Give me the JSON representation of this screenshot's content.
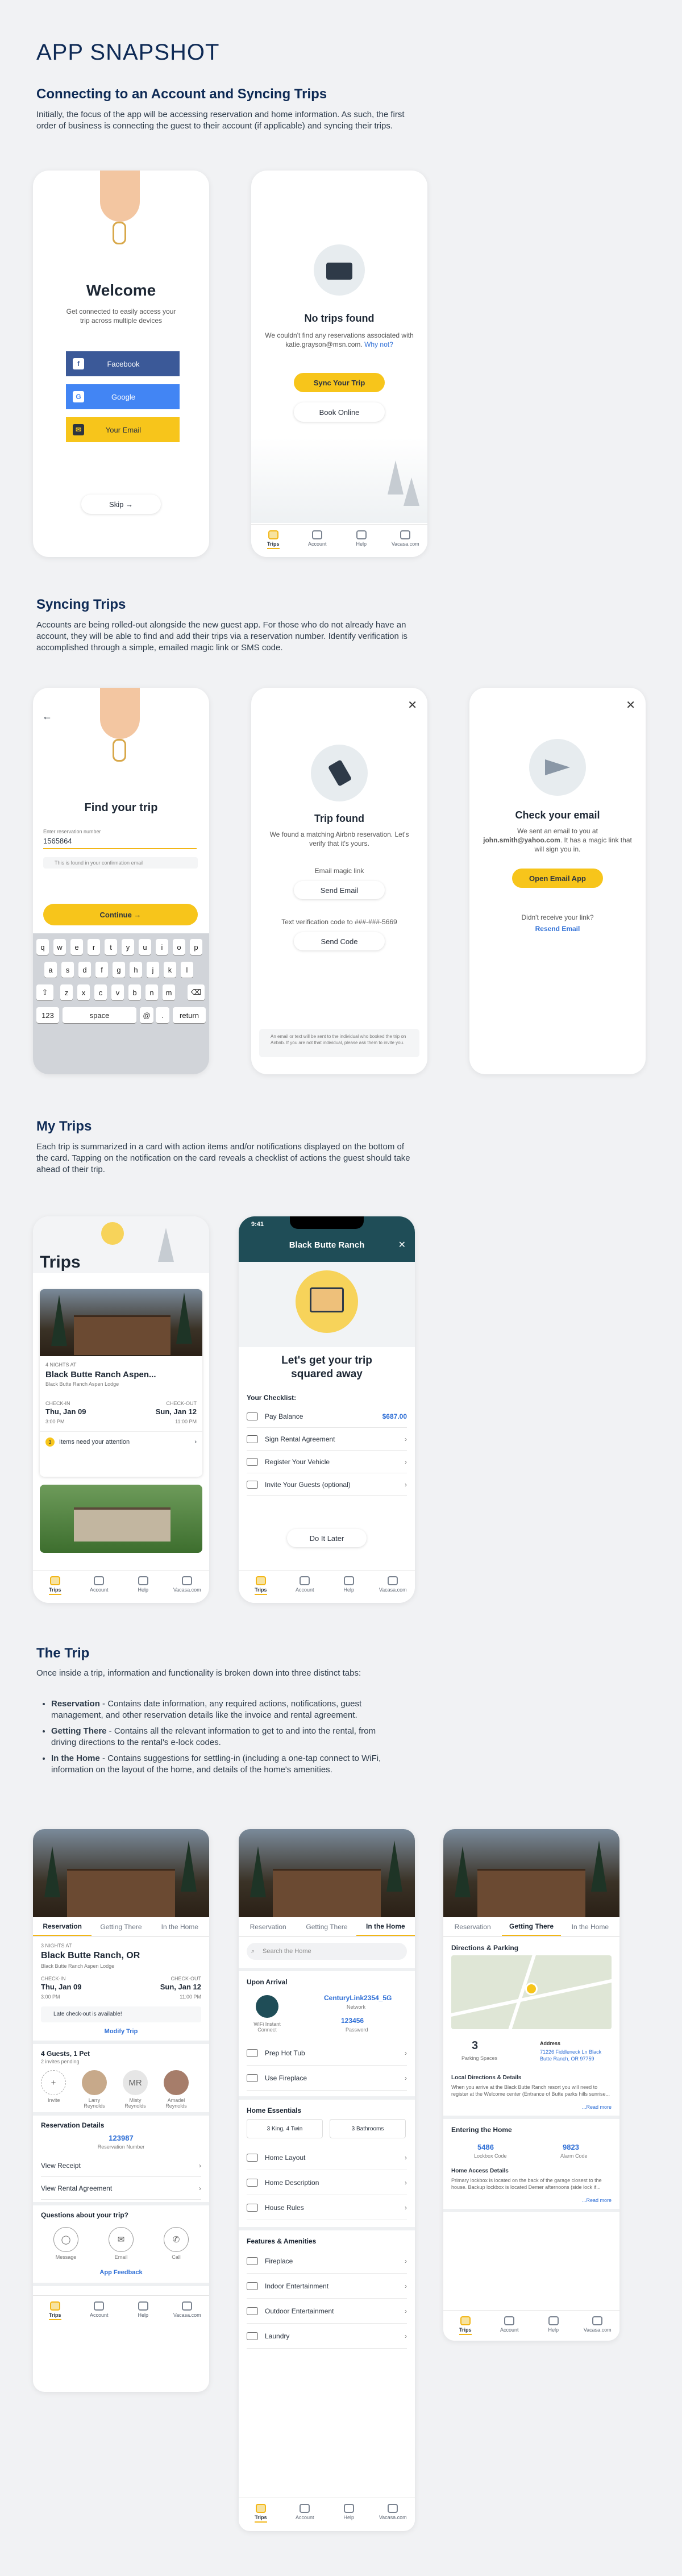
{
  "page_title": "APP SNAPSHOT",
  "sections": {
    "s1": {
      "title": "Connecting to an Account and Syncing Trips",
      "body": "Initially, the focus of the app will be accessing reservation and home information. As such, the first order of business is connecting the guest to their account (if applicable) and syncing their trips."
    },
    "s2": {
      "title": "Syncing Trips",
      "body": "Accounts are being rolled-out alongside the new guest app. For those who do not already have an account, they will be able to find and add their trips via a reservation number. Identify verification is accomplished through a simple, emailed magic link or SMS code."
    },
    "s3": {
      "title": "My Trips",
      "body": "Each trip is summarized in a card with action items and/or notifications displayed on the bottom of the card. Tapping on the notification on the card reveals a checklist of actions the guest should take ahead of their trip."
    },
    "s4": {
      "title": "The Trip",
      "intro": "Once inside a trip, information and functionality is broken down into three distinct tabs:",
      "bullets": [
        {
          "head": "Reservation",
          "text": " - Contains date information, any required actions, notifications, guest management, and other reservation details like the invoice and rental agreement."
        },
        {
          "head": "Getting There",
          "text": " - Contains all the relevant information to get to and into the rental, from driving directions to the rental's e-lock codes."
        },
        {
          "head": "In the Home",
          "text": " - Contains suggestions for settling-in (including a one-tap connect to WiFi, information on the layout of the home, and details of the home's amenities."
        }
      ]
    }
  },
  "tabs": {
    "trips": "Trips",
    "account": "Account",
    "help": "Help",
    "vacasa": "Vacasa.com"
  },
  "welcome": {
    "title": "Welcome",
    "sub": "Get connected to easily access your trip across multiple devices",
    "facebook": "Facebook",
    "google": "Google",
    "email": "Your Email",
    "skip": "Skip →",
    "fb_icon": "f",
    "g_icon": "G",
    "mail_icon": "✉"
  },
  "notrips": {
    "title": "No trips found",
    "sub": "We couldn't find any reservations associated with katie.grayson@msn.com.",
    "why": "Why not?",
    "sync": "Sync Your Trip",
    "book": "Book Online"
  },
  "find": {
    "back": "←",
    "title": "Find your trip",
    "label": "Enter reservation number",
    "value": "1565864",
    "note": "This is found in your confirmation email",
    "continue": "Continue  →",
    "keys_r1": [
      "q",
      "w",
      "e",
      "r",
      "t",
      "y",
      "u",
      "i",
      "o",
      "p"
    ],
    "keys_r2": [
      "a",
      "s",
      "d",
      "f",
      "g",
      "h",
      "j",
      "k",
      "l"
    ],
    "keys_r3": [
      "z",
      "x",
      "c",
      "v",
      "b",
      "n",
      "m"
    ],
    "shift": "⇧",
    "del": "⌫",
    "k123": "123",
    "space": "space",
    "at": "@",
    ".": ".",
    "ret": "return"
  },
  "found": {
    "title": "Trip found",
    "sub": "We found a matching Airbnb reservation. Let's verify that it's yours.",
    "email_label": "Email magic link",
    "send_email": "Send Email",
    "text_label": "Text verification code to ###-###-5669",
    "send_code": "Send Code",
    "foot": "An email or text will be sent to the individual who booked the trip on Airbnb. If you are not that individual, please ask them to invite you.",
    "close": "✕"
  },
  "check": {
    "title": "Check your email",
    "sub1": "We sent an email to you at",
    "email": "john.smith@yahoo.com",
    "sub2": ". It has a magic link that will sign you in.",
    "open": "Open Email App",
    "didnt": "Didn't receive your link?",
    "resend": "Resend Email",
    "close": "✕"
  },
  "trips": {
    "title": "Trips",
    "nights": "4 NIGHTS AT",
    "name": "Black Butte Ranch Aspen...",
    "sub": "Black Butte Ranch Aspen Lodge",
    "in_lbl": "CHECK-IN",
    "in": "Thu, Jan 09",
    "in_t": "3:00 PM",
    "out_lbl": "CHECK-OUT",
    "out": "Sun, Jan 12",
    "out_t": "11:00 PM",
    "notice": "Items need your attention",
    "notice_count": "3"
  },
  "checklist": {
    "time": "9:41",
    "header": "Black Butte Ranch",
    "title": "Let's get your trip squared away",
    "your": "Your Checklist:",
    "items": [
      {
        "label": "Pay Balance",
        "value": "$687.00"
      },
      {
        "label": "Sign Rental Agreement",
        "value": ""
      },
      {
        "label": "Register Your Vehicle",
        "value": ""
      },
      {
        "label": "Invite Your Guests (optional)",
        "value": ""
      }
    ],
    "later": "Do It Later",
    "close": "✕"
  },
  "toptabs": [
    "Reservation",
    "Getting There",
    "In the Home"
  ],
  "res": {
    "nights": "3 NIGHTS AT",
    "name": "Black Butte Ranch, OR",
    "sub": "Black Butte Ranch Aspen Lodge",
    "in_lbl": "CHECK-IN",
    "in": "Thu, Jan 09",
    "in_t": "3:00 PM",
    "out_lbl": "CHECK-OUT",
    "out": "Sun, Jan 12",
    "out_t": "11:00 PM",
    "late": "Late check-out is available!",
    "modify": "Modify Trip",
    "guests": "4 Guests, 1 Pet",
    "pending": "2 invites pending",
    "invite": "Invite",
    "people": [
      {
        "i": "",
        "n": "Larry Reynolds"
      },
      {
        "i": "MR",
        "n": "Misty Reynolds"
      },
      {
        "i": "",
        "n": "Amadel Reynolds"
      }
    ],
    "details": "Reservation Details",
    "resno": "123987",
    "resno_lbl": "Reservation Number",
    "receipt": "View Receipt",
    "agreement": "View Rental Agreement",
    "questions": "Questions about your trip?",
    "message": "Message",
    "email": "Email",
    "call": "Call",
    "feedback": "App Feedback"
  },
  "home": {
    "search": "Search the Home",
    "arrival": "Upon Arrival",
    "wifi": "WiFi Instant Connect",
    "network_v": "CenturyLink2354_5G",
    "network": "Network",
    "pw_v": "123456",
    "pw": "Password",
    "arr_items": [
      "Prep Hot Tub",
      "Use Fireplace"
    ],
    "essentials": "Home Essentials",
    "beds": "3 King, 4 Twin",
    "baths": "3 Bathrooms",
    "ess_items": [
      "Home Layout",
      "Home Description",
      "House Rules"
    ],
    "features": "Features & Amenities",
    "feat_items": [
      "Fireplace",
      "Indoor Entertainment",
      "Outdoor Entertainment",
      "Laundry"
    ]
  },
  "getting": {
    "dir": "Directions & Parking",
    "spaces": "3",
    "spaces_lbl": "Parking Spaces",
    "addr_lbl": "Address",
    "addr": "71226 Fiddleneck Ln Black Butte Ranch, OR 97759",
    "local": "Local Directions & Details",
    "local_txt": "When you arrive at the Black Butte Ranch resort you will need to register at the Welcome center (Entrance of Butte parks hills sunrise...",
    "more": "...Read more",
    "entering": "Entering the Home",
    "lockbox": "5486",
    "lockbox_lbl": "Lockbox Code",
    "alarm": "9823",
    "alarm_lbl": "Alarm Code",
    "access": "Home Access Details",
    "access_txt": "Primary lockbox is located on the back of the garage closest to the house. Backup lockbox is located Demer afternoons (side lock if...",
    "more2": "...Read more"
  },
  "colors": {
    "accent": "#f7c51b",
    "navy": "#0e2a55",
    "teal": "#1f4d57",
    "blue": "#2f6fd6"
  }
}
